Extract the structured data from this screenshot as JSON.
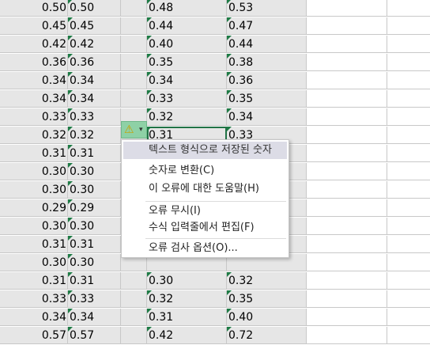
{
  "rows": [
    {
      "a": "0.50",
      "b": "0.50",
      "c": "0.48",
      "d": "0.53"
    },
    {
      "a": "0.45",
      "b": "0.45",
      "c": "0.44",
      "d": "0.47"
    },
    {
      "a": "0.42",
      "b": "0.42",
      "c": "0.40",
      "d": "0.44"
    },
    {
      "a": "0.36",
      "b": "0.36",
      "c": "0.35",
      "d": "0.38"
    },
    {
      "a": "0.34",
      "b": "0.34",
      "c": "0.34",
      "d": "0.36"
    },
    {
      "a": "0.34",
      "b": "0.34",
      "c": "0.33",
      "d": "0.35"
    },
    {
      "a": "0.33",
      "b": "0.33",
      "c": "0.32",
      "d": "0.34"
    },
    {
      "a": "0.32",
      "b": "0.32",
      "c": "0.31",
      "d": "0.33"
    },
    {
      "a": "0.31",
      "b": "0.31",
      "c": "",
      "d": ""
    },
    {
      "a": "0.30",
      "b": "0.30",
      "c": "",
      "d": ""
    },
    {
      "a": "0.30",
      "b": "0.30",
      "c": "",
      "d": ""
    },
    {
      "a": "0.29",
      "b": "0.29",
      "c": "",
      "d": ""
    },
    {
      "a": "0.30",
      "b": "0.30",
      "c": "",
      "d": ""
    },
    {
      "a": "0.31",
      "b": "0.31",
      "c": "",
      "d": ""
    },
    {
      "a": "0.30",
      "b": "0.30",
      "c": "",
      "d": ""
    },
    {
      "a": "0.31",
      "b": "0.31",
      "c": "0.30",
      "d": "0.32"
    },
    {
      "a": "0.33",
      "b": "0.33",
      "c": "0.32",
      "d": "0.35"
    },
    {
      "a": "0.34",
      "b": "0.34",
      "c": "0.31",
      "d": "0.40"
    },
    {
      "a": "0.57",
      "b": "0.57",
      "c": "0.42",
      "d": "0.72"
    }
  ],
  "selected_row_index": 7,
  "error_indicator": {
    "icon": "warning-icon",
    "dropdown_icon": "chevron-down-icon"
  },
  "context_menu": {
    "header": "텍스트 형식으로 저장된 숫자",
    "convert": "숫자로 변환(C)",
    "help": "이 오류에 대한 도움말(H)",
    "ignore": "오류 무시(I)",
    "edit_in_formula_bar": "수식 입력줄에서 편집(F)",
    "error_check_options": "오류 검사 옵션(O)..."
  },
  "colors": {
    "cell_shade": "#e6e6e6",
    "error_triangle": "#1e7b45",
    "selection": "#217346",
    "error_button": "#8ed1a6"
  }
}
